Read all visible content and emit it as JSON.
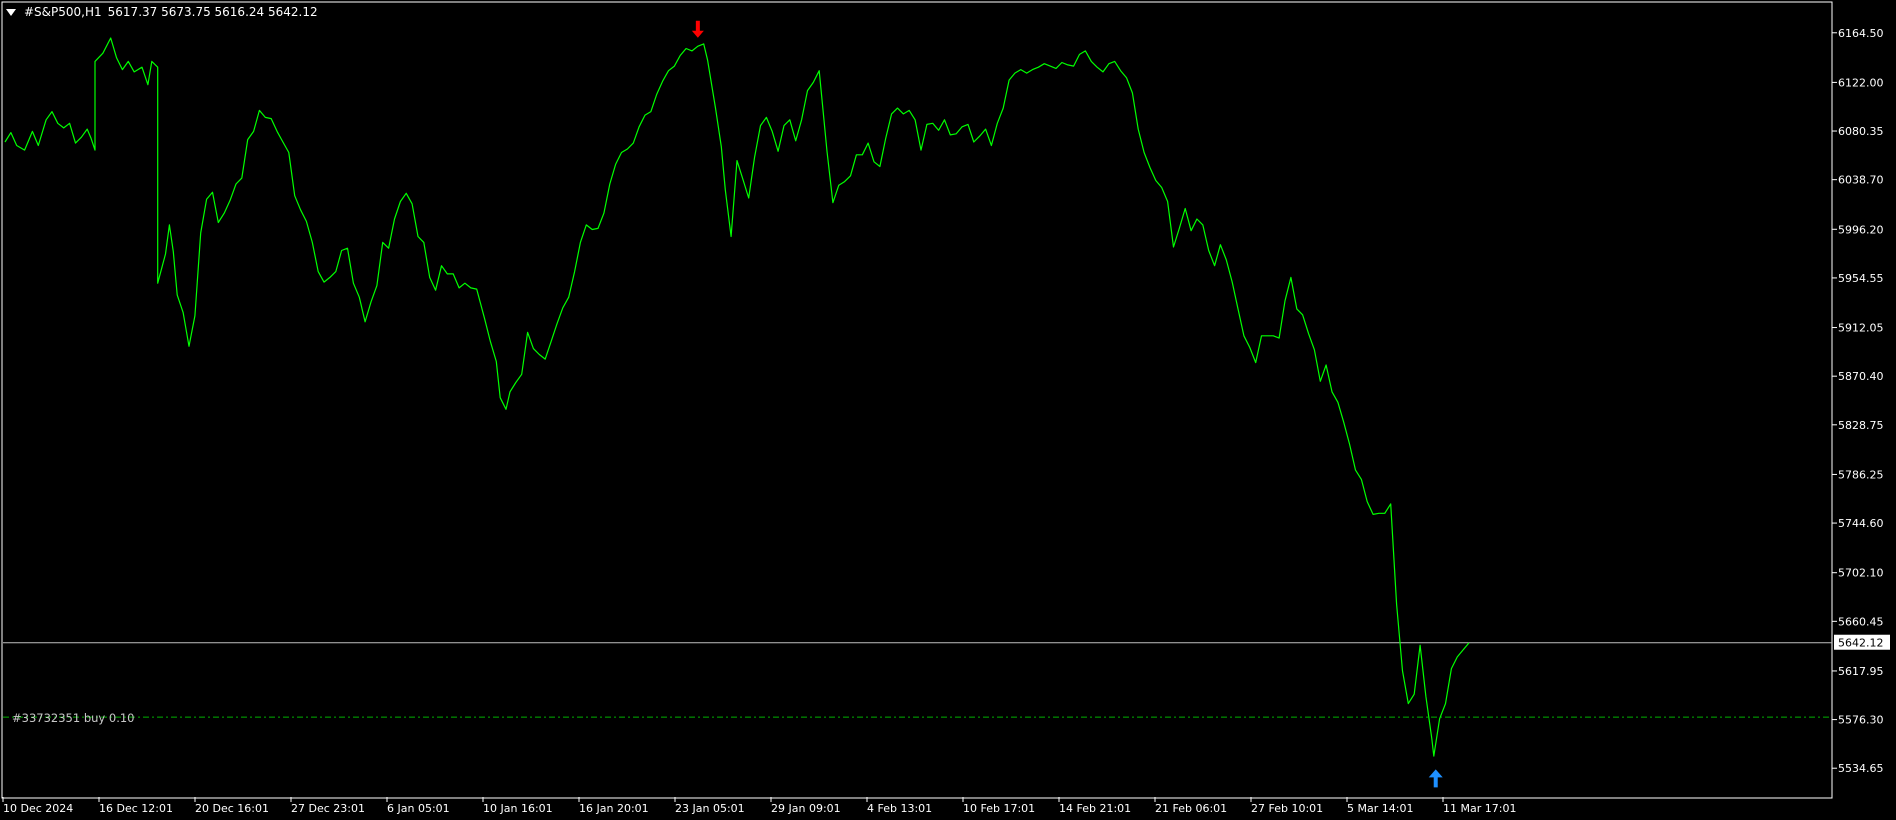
{
  "header": {
    "symbol": "#S&P500,H1",
    "ohlc": "5617.37 5673.75 5616.24 5642.12"
  },
  "order": {
    "label": "#33732351 buy 0.10",
    "price": 5578.4,
    "color": "#00b000"
  },
  "colors": {
    "background": "#000000",
    "price_line": "#00ff00",
    "grid_frame": "#ffffff",
    "sell_arrow": "#ff0000",
    "buy_arrow": "#1e90ff"
  },
  "chart_data": {
    "type": "line",
    "title": "",
    "timeframe": "H1",
    "ylim": [
      5510,
      6190
    ],
    "y_ticks": [
      "6164.50",
      "6122.00",
      "6080.35",
      "6038.70",
      "5996.20",
      "5954.55",
      "5912.05",
      "5870.40",
      "5828.75",
      "5786.25",
      "5744.60",
      "5702.10",
      "5660.45",
      "5617.95",
      "5576.30",
      "5534.65"
    ],
    "x_ticks": [
      "10 Dec 2024",
      "16 Dec 12:01",
      "20 Dec 16:01",
      "27 Dec 23:01",
      "6 Jan 05:01",
      "10 Jan 16:01",
      "16 Jan 20:01",
      "23 Jan 05:01",
      "29 Jan 09:01",
      "4 Feb 13:01",
      "10 Feb 17:01",
      "14 Feb 21:01",
      "21 Feb 06:01",
      "27 Feb 10:01",
      "5 Mar 14:01",
      "11 Mar 17:01"
    ],
    "current_price": "5642.12",
    "series": [
      {
        "name": "#S&P500,H1",
        "points": [
          [
            0,
            6071
          ],
          [
            3,
            6079
          ],
          [
            6,
            6068
          ],
          [
            10,
            6064
          ],
          [
            14,
            6080
          ],
          [
            17,
            6068
          ],
          [
            21,
            6090
          ],
          [
            24,
            6097
          ],
          [
            27,
            6087
          ],
          [
            30,
            6083
          ],
          [
            33,
            6087
          ],
          [
            36,
            6070
          ],
          [
            39,
            6075
          ],
          [
            42,
            6082
          ],
          [
            44,
            6074
          ],
          [
            46,
            6064
          ],
          [
            46,
            6140
          ],
          [
            50,
            6147
          ],
          [
            54,
            6160
          ],
          [
            57,
            6143
          ],
          [
            60,
            6133
          ],
          [
            63,
            6140
          ],
          [
            66,
            6131
          ],
          [
            70,
            6135
          ],
          [
            73,
            6120
          ],
          [
            75,
            6140
          ],
          [
            78,
            6135
          ],
          [
            78,
            5950
          ],
          [
            82,
            5975
          ],
          [
            84,
            6000
          ],
          [
            86,
            5977
          ],
          [
            88,
            5940
          ],
          [
            91,
            5925
          ],
          [
            94,
            5896
          ],
          [
            97,
            5922
          ],
          [
            100,
            5993
          ],
          [
            103,
            6022
          ],
          [
            106,
            6028
          ],
          [
            109,
            6002
          ],
          [
            112,
            6010
          ],
          [
            115,
            6021
          ],
          [
            118,
            6035
          ],
          [
            121,
            6040
          ],
          [
            124,
            6073
          ],
          [
            127,
            6080
          ],
          [
            130,
            6098
          ],
          [
            133,
            6092
          ],
          [
            136,
            6091
          ],
          [
            139,
            6080
          ],
          [
            142,
            6071
          ],
          [
            145,
            6062
          ],
          [
            148,
            6025
          ],
          [
            151,
            6013
          ],
          [
            154,
            6003
          ],
          [
            157,
            5985
          ],
          [
            160,
            5960
          ],
          [
            163,
            5951
          ],
          [
            166,
            5955
          ],
          [
            169,
            5960
          ],
          [
            172,
            5978
          ],
          [
            175,
            5980
          ],
          [
            178,
            5950
          ],
          [
            181,
            5938
          ],
          [
            184,
            5917
          ],
          [
            187,
            5934
          ],
          [
            190,
            5948
          ],
          [
            193,
            5985
          ],
          [
            196,
            5980
          ],
          [
            199,
            6005
          ],
          [
            202,
            6020
          ],
          [
            205,
            6027
          ],
          [
            208,
            6018
          ],
          [
            211,
            5990
          ],
          [
            214,
            5985
          ],
          [
            217,
            5955
          ],
          [
            220,
            5944
          ],
          [
            223,
            5965
          ],
          [
            226,
            5958
          ],
          [
            229,
            5958
          ],
          [
            232,
            5946
          ],
          [
            235,
            5950
          ],
          [
            238,
            5946
          ],
          [
            241,
            5945
          ],
          [
            245,
            5920
          ],
          [
            248,
            5900
          ],
          [
            251,
            5883
          ],
          [
            253,
            5852
          ],
          [
            256,
            5842
          ],
          [
            258,
            5857
          ],
          [
            261,
            5865
          ],
          [
            264,
            5872
          ],
          [
            267,
            5908
          ],
          [
            270,
            5894
          ],
          [
            273,
            5889
          ],
          [
            276,
            5885
          ],
          [
            279,
            5900
          ],
          [
            282,
            5915
          ],
          [
            285,
            5929
          ],
          [
            288,
            5938
          ],
          [
            291,
            5960
          ],
          [
            294,
            5985
          ],
          [
            297,
            6000
          ],
          [
            300,
            5996
          ],
          [
            303,
            5997
          ],
          [
            306,
            6010
          ],
          [
            309,
            6035
          ],
          [
            312,
            6052
          ],
          [
            315,
            6062
          ],
          [
            318,
            6065
          ],
          [
            321,
            6070
          ],
          [
            324,
            6084
          ],
          [
            327,
            6094
          ],
          [
            330,
            6097
          ],
          [
            333,
            6112
          ],
          [
            336,
            6123
          ],
          [
            339,
            6132
          ],
          [
            342,
            6136
          ],
          [
            345,
            6145
          ],
          [
            348,
            6151
          ],
          [
            351,
            6149
          ],
          [
            354,
            6153
          ],
          [
            357,
            6155
          ],
          [
            359,
            6141
          ],
          [
            363,
            6100
          ],
          [
            366,
            6067
          ],
          [
            368,
            6030
          ],
          [
            371,
            5990
          ],
          [
            374,
            6055
          ],
          [
            377,
            6039
          ],
          [
            380,
            6023
          ],
          [
            383,
            6058
          ],
          [
            386,
            6085
          ],
          [
            389,
            6092
          ],
          [
            392,
            6080
          ],
          [
            395,
            6063
          ],
          [
            398,
            6085
          ],
          [
            401,
            6090
          ],
          [
            404,
            6072
          ],
          [
            407,
            6090
          ],
          [
            410,
            6115
          ],
          [
            413,
            6122
          ],
          [
            416,
            6132
          ],
          [
            420,
            6063
          ],
          [
            423,
            6019
          ],
          [
            426,
            6034
          ],
          [
            429,
            6037
          ],
          [
            432,
            6042
          ],
          [
            435,
            6060
          ],
          [
            438,
            6060
          ],
          [
            441,
            6070
          ],
          [
            444,
            6054
          ],
          [
            447,
            6050
          ],
          [
            450,
            6074
          ],
          [
            453,
            6095
          ],
          [
            456,
            6100
          ],
          [
            459,
            6095
          ],
          [
            462,
            6098
          ],
          [
            465,
            6090
          ],
          [
            468,
            6064
          ],
          [
            471,
            6086
          ],
          [
            474,
            6087
          ],
          [
            477,
            6081
          ],
          [
            480,
            6090
          ],
          [
            483,
            6077
          ],
          [
            486,
            6078
          ],
          [
            489,
            6084
          ],
          [
            492,
            6086
          ],
          [
            495,
            6071
          ],
          [
            498,
            6076
          ],
          [
            501,
            6082
          ],
          [
            504,
            6068
          ],
          [
            507,
            6087
          ],
          [
            510,
            6100
          ],
          [
            513,
            6124
          ],
          [
            516,
            6130
          ],
          [
            519,
            6133
          ],
          [
            522,
            6130
          ],
          [
            525,
            6133
          ],
          [
            528,
            6135
          ],
          [
            531,
            6138
          ],
          [
            534,
            6136
          ],
          [
            537,
            6134
          ],
          [
            540,
            6139
          ],
          [
            543,
            6137
          ],
          [
            546,
            6136
          ],
          [
            549,
            6146
          ],
          [
            552,
            6149
          ],
          [
            555,
            6140
          ],
          [
            558,
            6135
          ],
          [
            561,
            6131
          ],
          [
            564,
            6138
          ],
          [
            567,
            6140
          ],
          [
            570,
            6132
          ],
          [
            573,
            6126
          ],
          [
            576,
            6113
          ],
          [
            579,
            6082
          ],
          [
            582,
            6062
          ],
          [
            585,
            6049
          ],
          [
            588,
            6038
          ],
          [
            591,
            6032
          ],
          [
            594,
            6020
          ],
          [
            597,
            5981
          ],
          [
            600,
            5997
          ],
          [
            603,
            6014
          ],
          [
            606,
            5995
          ],
          [
            609,
            6005
          ],
          [
            612,
            6000
          ],
          [
            615,
            5978
          ],
          [
            618,
            5965
          ],
          [
            621,
            5983
          ],
          [
            624,
            5970
          ],
          [
            627,
            5951
          ],
          [
            630,
            5928
          ],
          [
            633,
            5905
          ],
          [
            636,
            5895
          ],
          [
            639,
            5882
          ],
          [
            642,
            5905
          ],
          [
            645,
            5905
          ],
          [
            648,
            5905
          ],
          [
            651,
            5903
          ],
          [
            654,
            5935
          ],
          [
            657,
            5955
          ],
          [
            660,
            5928
          ],
          [
            663,
            5923
          ],
          [
            666,
            5907
          ],
          [
            669,
            5893
          ],
          [
            672,
            5866
          ],
          [
            675,
            5880
          ],
          [
            678,
            5857
          ],
          [
            681,
            5848
          ],
          [
            684,
            5831
          ],
          [
            687,
            5812
          ],
          [
            690,
            5790
          ],
          [
            693,
            5782
          ],
          [
            696,
            5763
          ],
          [
            699,
            5752
          ],
          [
            702,
            5753
          ],
          [
            705,
            5753
          ],
          [
            708,
            5761
          ],
          [
            711,
            5675
          ],
          [
            714,
            5618
          ],
          [
            717,
            5590
          ],
          [
            720,
            5598
          ],
          [
            723,
            5640
          ],
          [
            726,
            5596
          ],
          [
            729,
            5560
          ],
          [
            730,
            5545
          ],
          [
            733,
            5577
          ],
          [
            736,
            5590
          ],
          [
            739,
            5620
          ],
          [
            742,
            5630
          ],
          [
            745,
            5636
          ],
          [
            748,
            5642
          ]
        ]
      }
    ],
    "markers": [
      {
        "type": "sell",
        "x_index": 354,
        "price": 6168,
        "color": "#ff0000"
      },
      {
        "type": "buy",
        "x_index": 731,
        "price": 5526,
        "color": "#1e90ff"
      }
    ]
  }
}
